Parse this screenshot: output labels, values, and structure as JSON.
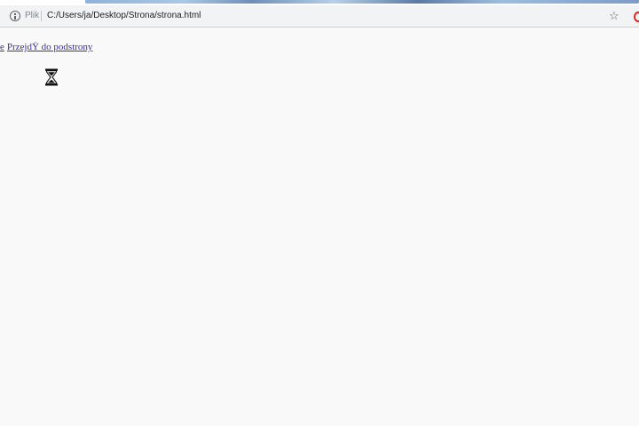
{
  "browser": {
    "scheme_label": "Plik",
    "url": "C:/Users/ja/Desktop/Strona/strona.html",
    "icons": {
      "info": "info-icon",
      "bookmark": "star-icon",
      "browser_logo": "opera-icon"
    }
  },
  "page": {
    "partial_link": "e",
    "link": "PrzejdŸ do podstrony",
    "cursor": "hourglass-icon"
  }
}
